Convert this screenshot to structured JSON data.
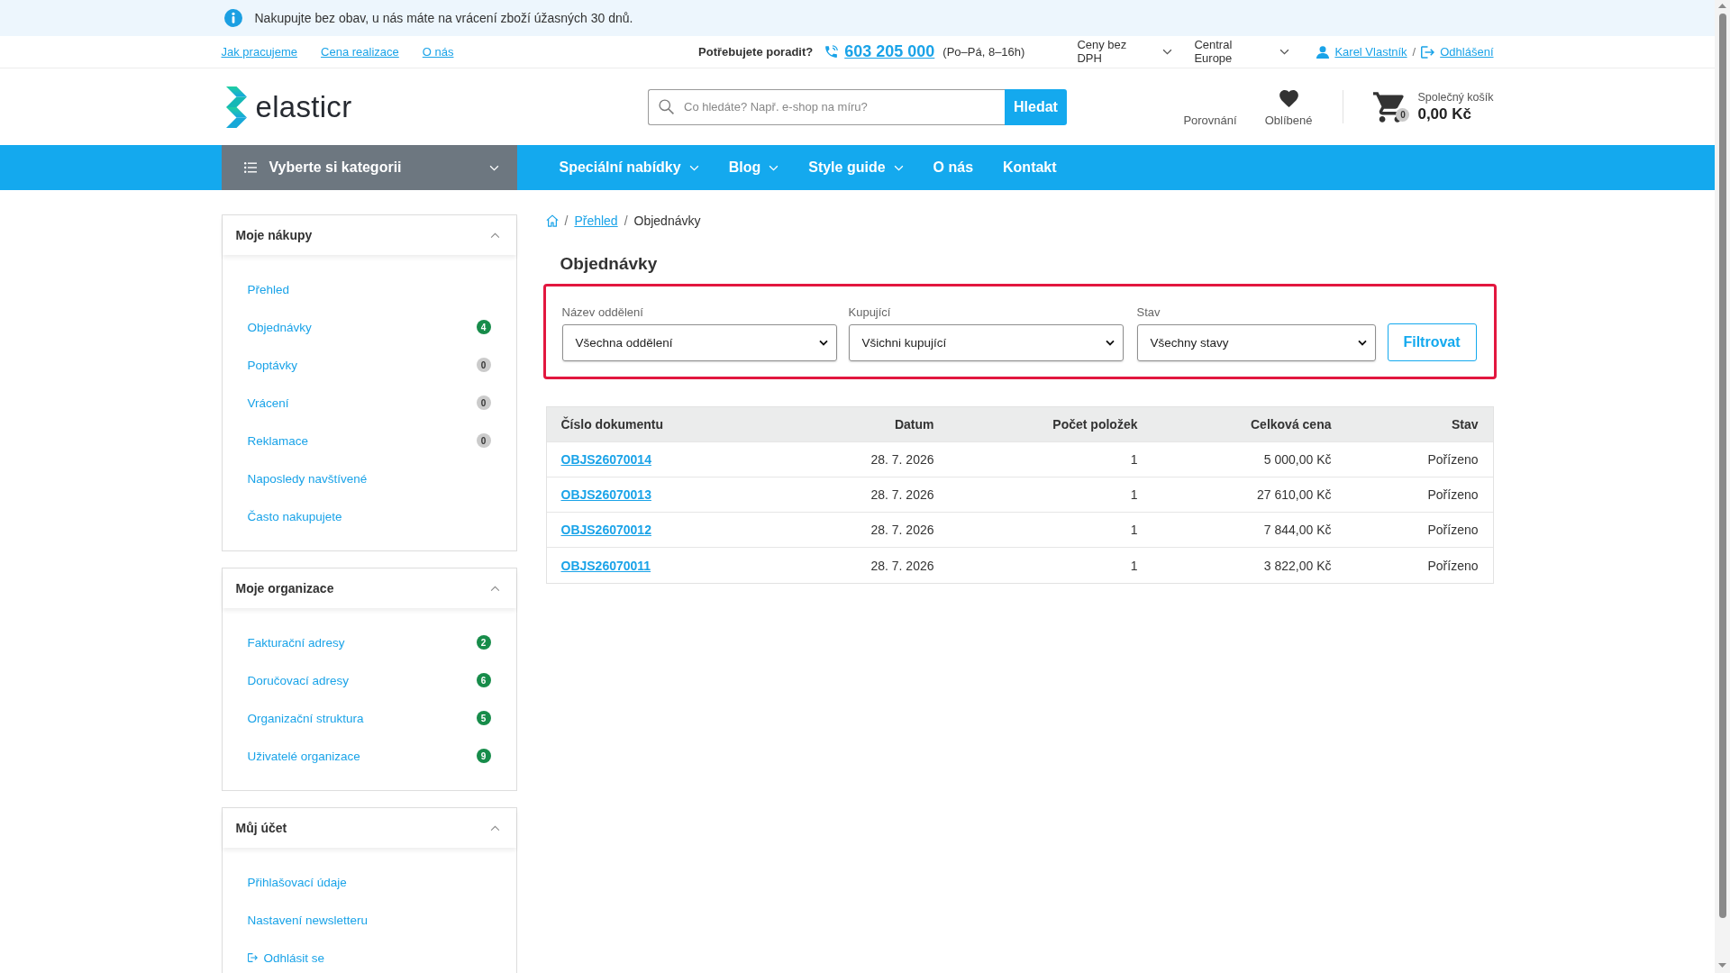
{
  "notice": {
    "text": "Nakupujte bez obav, u nás máte na vrácení zboží úžasných 30 dnů."
  },
  "top_links": [
    {
      "label": "Jak pracujeme"
    },
    {
      "label": "Cena realizace"
    },
    {
      "label": "O nás"
    }
  ],
  "support": {
    "label": "Potřebujete poradit?",
    "phone": "603 205 000",
    "hours": "(Po–Pá, 8–16h)"
  },
  "selectors": [
    {
      "value": "Ceny bez DPH"
    },
    {
      "value": "Central Europe"
    }
  ],
  "account": {
    "name": "Karel Vlastník",
    "separator": "/",
    "logout": "Odhlášení"
  },
  "logo": {
    "text": "elasticr"
  },
  "search": {
    "placeholder": "Co hledáte? Např. e-shop na míru?",
    "button": "Hledat"
  },
  "header_links": [
    {
      "kind": "compare",
      "label": "Porovnání"
    },
    {
      "kind": "favorites",
      "label": "Oblíbené"
    }
  ],
  "cart": {
    "label": "Společný košík",
    "count": "0",
    "total": "0,00 Kč"
  },
  "category_menu": {
    "label": "Vyberte si kategorii"
  },
  "nav": [
    {
      "label": "Speciální nabídky",
      "dropdown": true
    },
    {
      "label": "Blog",
      "dropdown": true
    },
    {
      "label": "Style guide",
      "dropdown": true
    },
    {
      "label": "O nás",
      "dropdown": false
    },
    {
      "label": "Kontakt",
      "dropdown": false
    }
  ],
  "sidebar": {
    "sections": [
      {
        "title": "Moje nákupy",
        "expanded": true,
        "items": [
          {
            "kind": "link",
            "label": "Přehled"
          },
          {
            "kind": "link",
            "label": "Objednávky",
            "badge": {
              "text": "4",
              "color": "#178c4a"
            }
          },
          {
            "kind": "link",
            "label": "Poptávky",
            "badge": {
              "text": "0",
              "color": "#cbcbcb"
            }
          },
          {
            "kind": "link",
            "label": "Vrácení",
            "badge": {
              "text": "0",
              "color": "#cbcbcb"
            }
          },
          {
            "kind": "link",
            "label": "Reklamace",
            "badge": {
              "text": "0",
              "color": "#cbcbcb"
            }
          },
          {
            "kind": "link",
            "label": "Naposledy navštívené"
          },
          {
            "kind": "link",
            "label": "Často nakupujete"
          }
        ]
      },
      {
        "title": "Moje organizace",
        "expanded": true,
        "items": [
          {
            "kind": "link",
            "label": "Fakturační adresy",
            "badge": {
              "text": "2",
              "color": "#178c4a"
            }
          },
          {
            "kind": "link",
            "label": "Doručovací adresy",
            "badge": {
              "text": "6",
              "color": "#178c4a"
            }
          },
          {
            "kind": "link",
            "label": "Organizační struktura",
            "badge": {
              "text": "5",
              "color": "#178c4a"
            }
          },
          {
            "kind": "link",
            "label": "Uživatelé organizace",
            "badge": {
              "text": "9",
              "color": "#178c4a"
            }
          }
        ]
      },
      {
        "title": "Můj účet",
        "expanded": true,
        "items": [
          {
            "kind": "link",
            "label": "Přihlašovací údaje"
          },
          {
            "kind": "link",
            "label": "Nastavení newsletteru"
          },
          {
            "kind": "logout",
            "label": "Odhlásit se"
          }
        ]
      }
    ]
  },
  "breadcrumb": {
    "separator": "/",
    "items": [
      {
        "label": "Přehled",
        "link": true
      },
      {
        "label": "Objednávky",
        "link": false
      }
    ]
  },
  "page_title": "Objednávky",
  "filters": {
    "highlighted": true,
    "fields": [
      {
        "label": "Název oddělení",
        "value": "Všechna oddělení"
      },
      {
        "label": "Kupující",
        "value": "Všichni kupující"
      },
      {
        "label": "Stav",
        "value": "Všechny stavy"
      }
    ],
    "button": "Filtrovat"
  },
  "table": {
    "columns": [
      "Číslo dokumentu",
      "Datum",
      "Počet položek",
      "Celková cena",
      "Stav"
    ],
    "rows": [
      [
        "OBJS26070014",
        "28. 7. 2026",
        "1",
        "5 000,00 Kč",
        "Pořízeno"
      ],
      [
        "OBJS26070013",
        "28. 7. 2026",
        "1",
        "27 610,00 Kč",
        "Pořízeno"
      ],
      [
        "OBJS26070012",
        "28. 7. 2026",
        "1",
        "7 844,00 Kč",
        "Pořízeno"
      ],
      [
        "OBJS26070011",
        "28. 7. 2026",
        "1",
        "3 822,00 Kč",
        "Pořízeno"
      ]
    ]
  }
}
